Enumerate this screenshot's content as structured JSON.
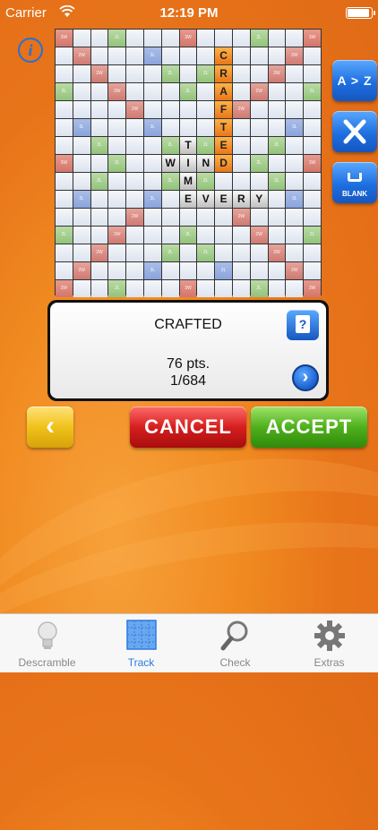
{
  "status_bar": {
    "carrier": "Carrier",
    "time": "12:19 PM",
    "battery_level": 0.95
  },
  "info_button": {
    "glyph": "i"
  },
  "board": {
    "rows": [
      "TW,,,DL,,,,TW,,,,DL,,,TW",
      ",DW,,,,TL,,,,TL,,,,DW,",
      ",,DW,,,,DL,,DL,,,,DW,,",
      "DL,,,DW,,,,DL,,,,DW,,,DL",
      ",,,,DW,,,,,,DW,,,,",
      ",TL,,,,TL,,,,TL,,,,TL,",
      ",,DL,,,,DL,,DL,,,,DL,,",
      "TW,,,DL,,,,DW,,,,DL,,,TW",
      ",,DL,,,,DL,,DL,,,,DL,,",
      ",TL,,,,TL,,,,TL,,,,TL,",
      ",,,,DW,,,,,,DW,,,,",
      "DL,,,DW,,,,DL,,,,DW,,,DL",
      ",,DW,,,,DL,,DL,,,,DW,,",
      ",DW,,,,TL,,,,TL,,,,DW,",
      "TW,,,DL,,,,TW,,,,DL,,,TW"
    ],
    "premium_labels": {
      "TW": "3W",
      "DW": "2W",
      "TL": "3L",
      "DL": "2L"
    },
    "tiles": [
      {
        "r": 1,
        "c": 9,
        "letter": "C",
        "new": true
      },
      {
        "r": 2,
        "c": 9,
        "letter": "R",
        "new": true
      },
      {
        "r": 3,
        "c": 9,
        "letter": "A",
        "new": true
      },
      {
        "r": 4,
        "c": 9,
        "letter": "F",
        "new": true
      },
      {
        "r": 5,
        "c": 9,
        "letter": "T",
        "new": true
      },
      {
        "r": 6,
        "c": 9,
        "letter": "E",
        "new": true
      },
      {
        "r": 7,
        "c": 9,
        "letter": "D",
        "new": true
      },
      {
        "r": 6,
        "c": 7,
        "letter": "T",
        "new": false
      },
      {
        "r": 7,
        "c": 6,
        "letter": "W",
        "new": false
      },
      {
        "r": 7,
        "c": 7,
        "letter": "I",
        "new": false
      },
      {
        "r": 7,
        "c": 8,
        "letter": "N",
        "new": false
      },
      {
        "r": 8,
        "c": 7,
        "letter": "M",
        "new": false
      },
      {
        "r": 9,
        "c": 7,
        "letter": "E",
        "new": false
      },
      {
        "r": 9,
        "c": 8,
        "letter": "V",
        "new": false
      },
      {
        "r": 9,
        "c": 9,
        "letter": "E",
        "new": false
      },
      {
        "r": 9,
        "c": 10,
        "letter": "R",
        "new": false
      },
      {
        "r": 9,
        "c": 11,
        "letter": "Y",
        "new": false
      }
    ]
  },
  "side_buttons": {
    "sort_label": "A > Z",
    "clear_glyph": "✕",
    "blank_label": "BLANK"
  },
  "result": {
    "word": "CRAFTED",
    "points": "76 pts.",
    "index": "1/684",
    "dict_glyph": "?",
    "next_glyph": "›"
  },
  "actions": {
    "back_glyph": "‹",
    "cancel_label": "CANCEL",
    "accept_label": "ACCEPT"
  },
  "tabs": [
    {
      "label": "Descramble",
      "icon": "lightbulb-icon",
      "active": false
    },
    {
      "label": "Track",
      "icon": "grid-icon",
      "active": true
    },
    {
      "label": "Check",
      "icon": "magnifier-icon",
      "active": false
    },
    {
      "label": "Extras",
      "icon": "gear-icon",
      "active": false
    }
  ]
}
